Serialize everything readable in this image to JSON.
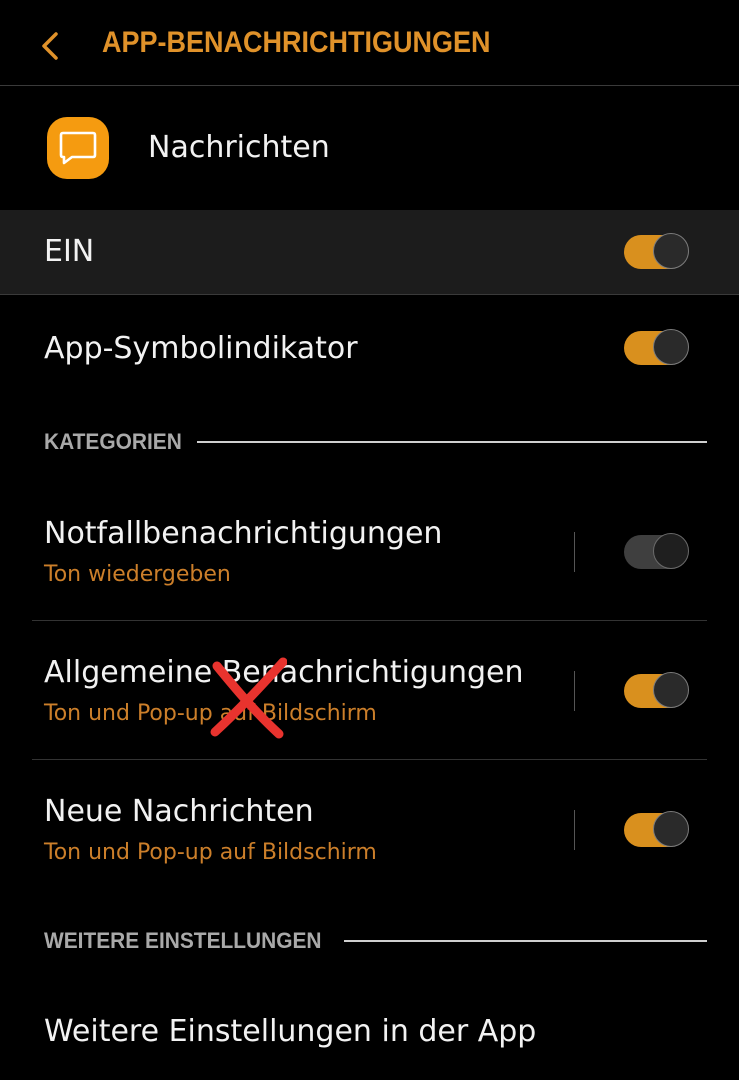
{
  "header": {
    "title": "APP-BENACHRICHTIGUNGEN",
    "back_icon": "chevron-left-icon"
  },
  "app": {
    "name": "Nachrichten",
    "icon": "message-bubble-icon",
    "icon_color": "#f59b10"
  },
  "master": {
    "label": "EIN",
    "enabled": true
  },
  "badge": {
    "label": "App-Symbolindikator",
    "enabled": true
  },
  "sections": {
    "categories": "KATEGORIEN",
    "more": "WEITERE EINSTELLUNGEN"
  },
  "categories": [
    {
      "title": "Notfallbenachrichtigungen",
      "subtitle": "Ton wiedergeben",
      "enabled": false
    },
    {
      "title": "Allgemeine Benachrichtigungen",
      "subtitle": "Ton und Pop-up auf Bildschirm",
      "enabled": true
    },
    {
      "title": "Neue Nachrichten",
      "subtitle": "Ton und Pop-up auf Bildschirm",
      "enabled": true
    }
  ],
  "more_settings": {
    "label": "Weitere Einstellungen in der App"
  },
  "annotation": {
    "icon": "red-x-mark",
    "color": "#e8332e"
  },
  "colors": {
    "accent": "#e0922a",
    "subtitle": "#cc7f2a",
    "toggle_on": "#d9901e",
    "toggle_off": "#3f3f3f",
    "background": "#000000"
  }
}
